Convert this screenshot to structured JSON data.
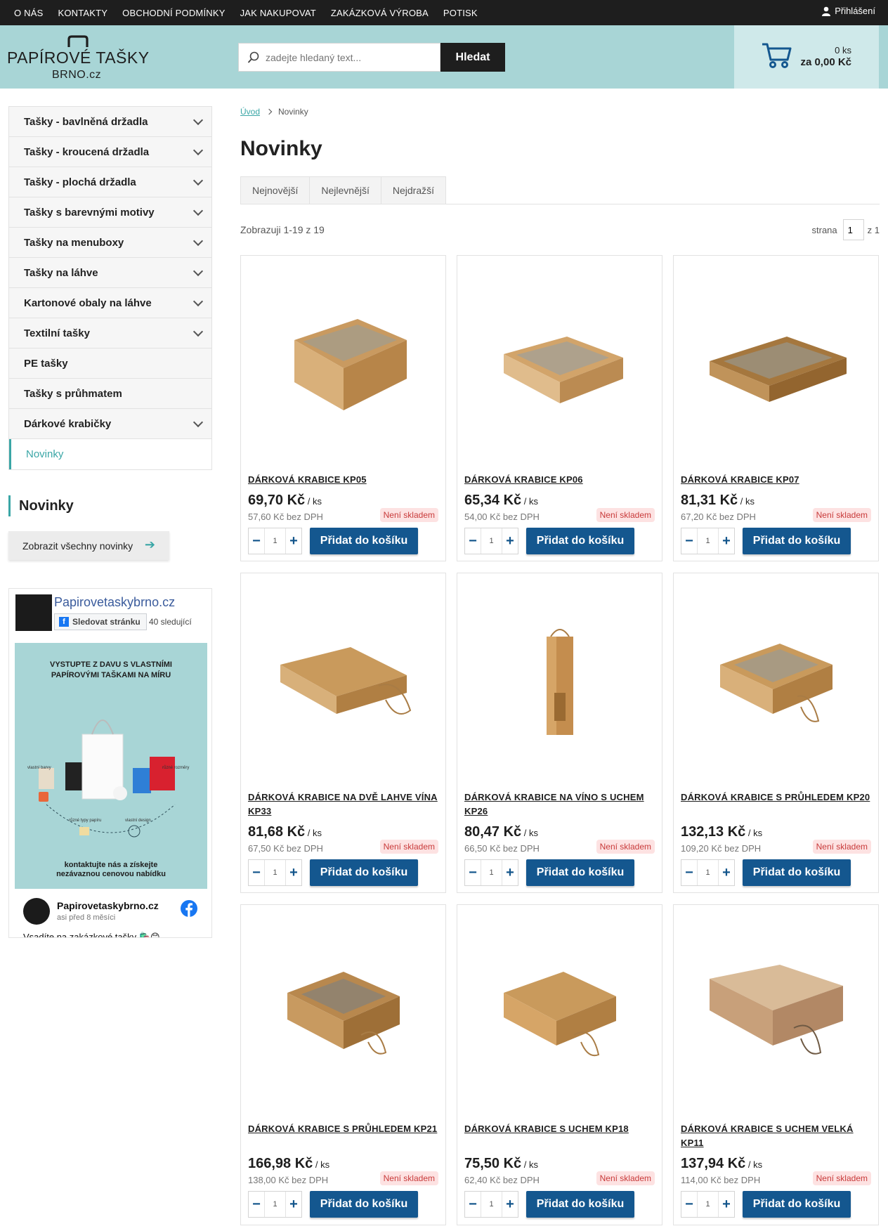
{
  "topnav": [
    "O NÁS",
    "KONTAKTY",
    "OBCHODNÍ PODMÍNKY",
    "JAK NAKUPOVAT",
    "ZAKÁZKOVÁ VÝROBA",
    "POTISK"
  ],
  "login": "Přihlášení",
  "logo": {
    "line1": "PAPÍROVÉ TAŠKY",
    "line2": "BRNO.cz"
  },
  "search": {
    "placeholder": "zadejte hledaný text...",
    "button": "Hledat"
  },
  "cart": {
    "count": "0 ks",
    "total": "za 0,00 Kč"
  },
  "categories": [
    "Tašky - bavlněná držadla",
    "Tašky - kroucená držadla",
    "Tašky - plochá držadla",
    "Tašky s barevnými motivy",
    "Tašky na menuboxy",
    "Tašky na láhve",
    "Kartonové obaly na láhve",
    "Textilní tašky",
    "PE tašky",
    "Tašky s průhmatem",
    "Dárkové krabičky",
    "Novinky"
  ],
  "sidebar_news": {
    "title": "Novinky",
    "button": "Zobrazit všechny novinky"
  },
  "facebook": {
    "page_name": "Papirovetaskybrno.cz",
    "follow": "Sledovat stránku",
    "followers": "40 sledující",
    "poster_title": "VYSTUPTE Z DAVU S VLASTNÍMI PAPÍROVÝMI TAŠKAMI NA MÍRU",
    "poster_footer": "kontaktujte nás a získejte nezávaznou cenovou nabídku",
    "label_colors": "vlastní barvy",
    "label_sizes": "různé rozměry",
    "label_papers": "různé typy papíru",
    "label_design": "vlastní design",
    "post_author": "Papirovetaskybrno.cz",
    "post_time": "asi před 8 měsíci",
    "post_text": "Vsadíte na zakázkové tašky 🛍️😊"
  },
  "breadcrumb": {
    "home": "Úvod",
    "current": "Novinky"
  },
  "page_title": "Novinky",
  "sort_tabs": [
    "Nejnovější",
    "Nejlevnější",
    "Nejdražší"
  ],
  "showing": "Zobrazuji 1-19 z 19",
  "pager": {
    "label": "strana",
    "page": "1",
    "of": "z 1"
  },
  "product_common": {
    "unit": " / ks",
    "stock": "Není skladem",
    "add": "Přidat do košíku",
    "qty": "1"
  },
  "products": [
    {
      "name": "DÁRKOVÁ KRABICE KP05",
      "price": "69,70 Kč",
      "net": "57,60 Kč bez DPH"
    },
    {
      "name": "DÁRKOVÁ KRABICE KP06",
      "price": "65,34 Kč",
      "net": "54,00 Kč bez DPH"
    },
    {
      "name": "DÁRKOVÁ KRABICE KP07",
      "price": "81,31 Kč",
      "net": "67,20 Kč bez DPH"
    },
    {
      "name": "DÁRKOVÁ KRABICE NA DVĚ LAHVE VÍNA KP33",
      "price": "81,68 Kč",
      "net": "67,50 Kč bez DPH"
    },
    {
      "name": "DÁRKOVÁ KRABICE NA VÍNO S UCHEM KP26",
      "price": "80,47 Kč",
      "net": "66,50 Kč bez DPH"
    },
    {
      "name": "DÁRKOVÁ KRABICE S PRŮHLEDEM KP20",
      "price": "132,13 Kč",
      "net": "109,20 Kč bez DPH"
    },
    {
      "name": "DÁRKOVÁ KRABICE S PRŮHLEDEM KP21",
      "price": "166,98 Kč",
      "net": "138,00 Kč bez DPH"
    },
    {
      "name": "DÁRKOVÁ KRABICE S UCHEM KP18",
      "price": "75,50 Kč",
      "net": "62,40 Kč bez DPH"
    },
    {
      "name": "DÁRKOVÁ KRABICE S UCHEM VELKÁ KP11",
      "price": "137,94 Kč",
      "net": "114,00 Kč bez DPH"
    }
  ]
}
